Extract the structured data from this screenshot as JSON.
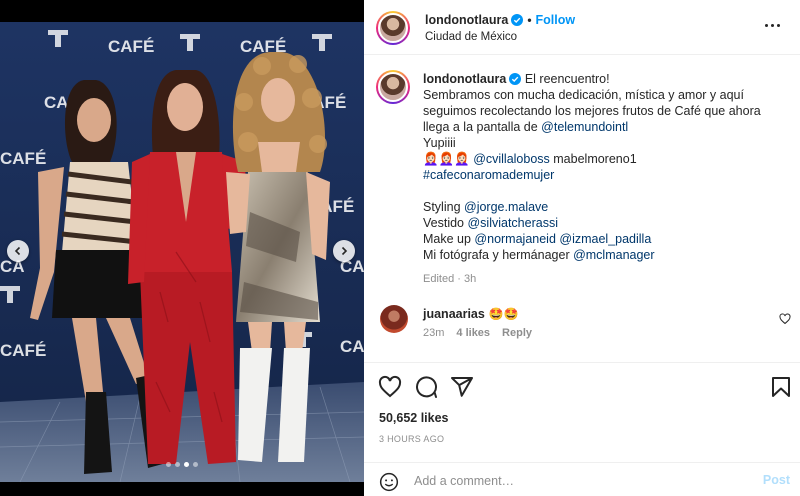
{
  "post": {
    "username": "londonotlaura",
    "follow_label": "Follow",
    "separator": "•",
    "location": "Ciudad de México",
    "more_icon": "more-horizontal-icon"
  },
  "media": {
    "slide_count": 4,
    "active_slide": 3,
    "backdrop_logos": [
      "CAFÉ",
      "TELEMUNDO"
    ],
    "prev_icon": "chevron-left-icon",
    "next_icon": "chevron-right-icon"
  },
  "caption": {
    "username": "londonotlaura",
    "lines": {
      "l1": "El reencuentro!",
      "l2": "Sembramos con mucha dedicación, mística y amor y aquí",
      "l3": "seguimos recolectando los mejores frutos de Café que ahora",
      "l4_prefix": "llega a la pantalla de ",
      "l4_link": "@telemundointl",
      "l5": "Yupiiii",
      "l6_emoji": "👩🏻‍🦰👩🏻‍🦰👩🏻‍🦰",
      "l6_link": "@cvillaloboss",
      "l6_suffix": " mabelmoreno1",
      "l7_link": "#cafeconaromademujer",
      "l8_prefix": "Styling ",
      "l8_link": "@jorge.malave",
      "l9_prefix": "Vestido ",
      "l9_link": "@silviatcherassi",
      "l10_prefix": "Make up ",
      "l10_link1": "@normajaneid",
      "l10_link2": "@izmael_padilla",
      "l11_prefix": "Mi fotógrafa y hermánager ",
      "l11_link": "@mclmanager"
    },
    "edited_label": "Edited",
    "edited_time": "3h"
  },
  "comment": {
    "username": "juanaarias",
    "text": "🤩🤩",
    "time": "23m",
    "likes": "4 likes",
    "reply_label": "Reply"
  },
  "actions": {
    "like_icon": "heart-icon",
    "comment_icon": "comment-icon",
    "share_icon": "share-icon",
    "save_icon": "bookmark-icon",
    "likes_count": "50,652 likes",
    "time_ago": "3 HOURS AGO"
  },
  "comment_input": {
    "placeholder": "Add a comment…",
    "post_label": "Post"
  },
  "colors": {
    "accent": "#0095f6",
    "verified": "#0095f6",
    "post_disabled": "#b2dffc",
    "backdrop": "#1b2f58"
  }
}
